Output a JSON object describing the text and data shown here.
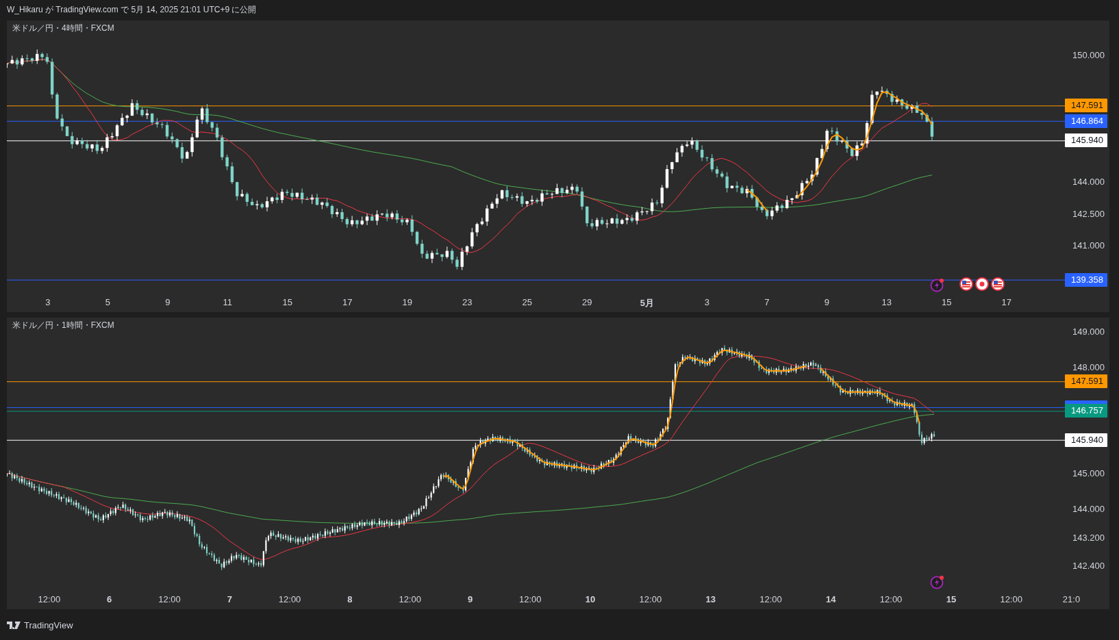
{
  "header": {
    "text": "W_Hikaru が TradingView.com で 5月 14, 2025 21:01 UTC+9 に公開"
  },
  "panels": [
    {
      "title": "米ドル／円・4時間・FXCM",
      "price_ticks": [
        "150.000",
        "144.000",
        "142.500",
        "141.000"
      ],
      "price_lines": [
        {
          "label": "147.591",
          "color": "#ff9800"
        },
        {
          "label": "146.864",
          "color": "#2962ff"
        },
        {
          "label": "145.940",
          "color": "#ffffff"
        },
        {
          "label": "139.358",
          "color": "#2962ff"
        }
      ],
      "time_labels": [
        {
          "text": "3",
          "bold": false
        },
        {
          "text": "5",
          "bold": false
        },
        {
          "text": "9",
          "bold": false
        },
        {
          "text": "11",
          "bold": false
        },
        {
          "text": "15",
          "bold": false
        },
        {
          "text": "17",
          "bold": false
        },
        {
          "text": "19",
          "bold": false
        },
        {
          "text": "23",
          "bold": false
        },
        {
          "text": "25",
          "bold": false
        },
        {
          "text": "29",
          "bold": false
        },
        {
          "text": "5月",
          "bold": true
        },
        {
          "text": "3",
          "bold": false
        },
        {
          "text": "7",
          "bold": false
        },
        {
          "text": "9",
          "bold": false
        },
        {
          "text": "13",
          "bold": false
        },
        {
          "text": "15",
          "bold": false
        },
        {
          "text": "17",
          "bold": false
        }
      ]
    },
    {
      "title": "米ドル／円・1時間・FXCM",
      "price_ticks": [
        "149.000",
        "148.000",
        "145.000",
        "144.000",
        "143.200",
        "142.400"
      ],
      "price_lines": [
        {
          "label": "147.591",
          "color": "#ff9800"
        },
        {
          "color": "#2962ff"
        },
        {
          "label": "146.757",
          "color": "#089981"
        },
        {
          "label": "145.940",
          "color": "#ffffff"
        }
      ],
      "time_labels": [
        {
          "text": "12:00",
          "bold": false
        },
        {
          "text": "6",
          "bold": true
        },
        {
          "text": "12:00",
          "bold": false
        },
        {
          "text": "7",
          "bold": true
        },
        {
          "text": "12:00",
          "bold": false
        },
        {
          "text": "8",
          "bold": true
        },
        {
          "text": "12:00",
          "bold": false
        },
        {
          "text": "9",
          "bold": true
        },
        {
          "text": "12:00",
          "bold": false
        },
        {
          "text": "10",
          "bold": true
        },
        {
          "text": "12:00",
          "bold": false
        },
        {
          "text": "13",
          "bold": true
        },
        {
          "text": "12:00",
          "bold": false
        },
        {
          "text": "14",
          "bold": true
        },
        {
          "text": "12:00",
          "bold": false
        },
        {
          "text": "15",
          "bold": true
        },
        {
          "text": "12:00",
          "bold": false
        },
        {
          "text": "21:0",
          "bold": false
        }
      ]
    }
  ],
  "footer": {
    "brand": "TradingView"
  }
}
